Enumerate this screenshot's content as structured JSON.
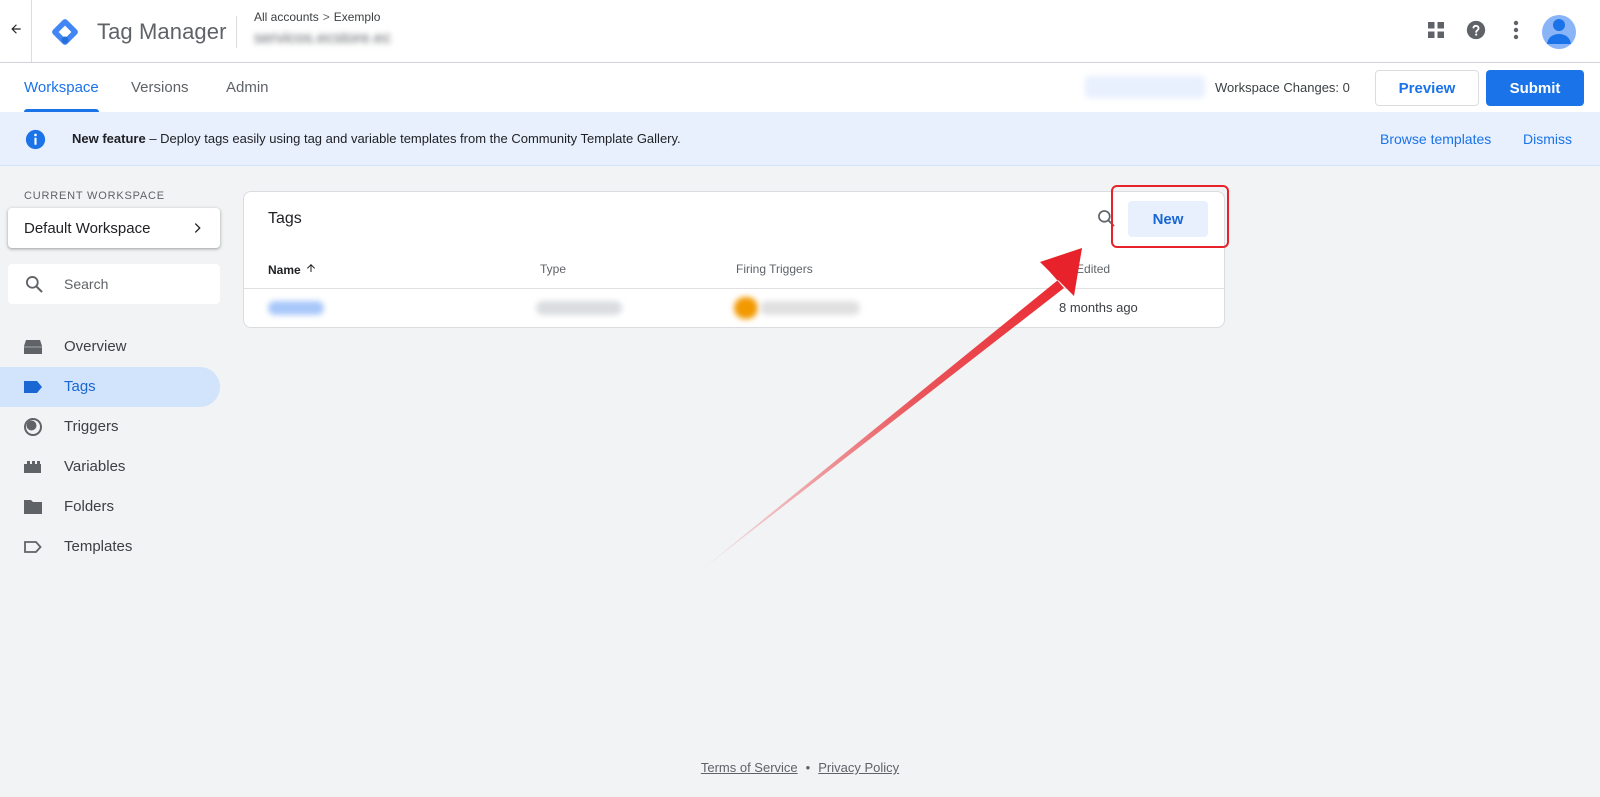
{
  "header": {
    "app_title": "Tag Manager",
    "breadcrumb": {
      "accounts": "All accounts",
      "separator": ">",
      "account": "Exemplo"
    },
    "container_name": "servicos.ecstore.ec"
  },
  "tabs": [
    {
      "label": "Workspace",
      "active": true
    },
    {
      "label": "Versions",
      "active": false
    },
    {
      "label": "Admin",
      "active": false
    }
  ],
  "toolbar": {
    "workspace_changes": "Workspace Changes: 0",
    "preview_label": "Preview",
    "submit_label": "Submit"
  },
  "banner": {
    "title": "New feature",
    "text": " – Deploy tags easily using tag and variable templates from the Community Template Gallery.",
    "browse_label": "Browse templates",
    "dismiss_label": "Dismiss"
  },
  "sidebar": {
    "workspace_label": "CURRENT WORKSPACE",
    "workspace_name": "Default Workspace",
    "search_placeholder": "Search",
    "items": [
      {
        "label": "Overview",
        "icon": "overview-icon",
        "active": false
      },
      {
        "label": "Tags",
        "icon": "tag-icon",
        "active": true
      },
      {
        "label": "Triggers",
        "icon": "trigger-icon",
        "active": false
      },
      {
        "label": "Variables",
        "icon": "variables-icon",
        "active": false
      },
      {
        "label": "Folders",
        "icon": "folder-icon",
        "active": false
      },
      {
        "label": "Templates",
        "icon": "template-icon",
        "active": false
      }
    ]
  },
  "tags_table": {
    "title": "Tags",
    "new_label": "New",
    "columns": [
      "Name",
      "Type",
      "Firing Triggers",
      "Last Edited"
    ],
    "rows": [
      {
        "last_edited": "8 months ago"
      }
    ]
  },
  "footer": {
    "terms": "Terms of Service",
    "separator": "•",
    "privacy": "Privacy Policy"
  },
  "colors": {
    "accent": "#1a73e8",
    "highlight": "#e8222a"
  }
}
